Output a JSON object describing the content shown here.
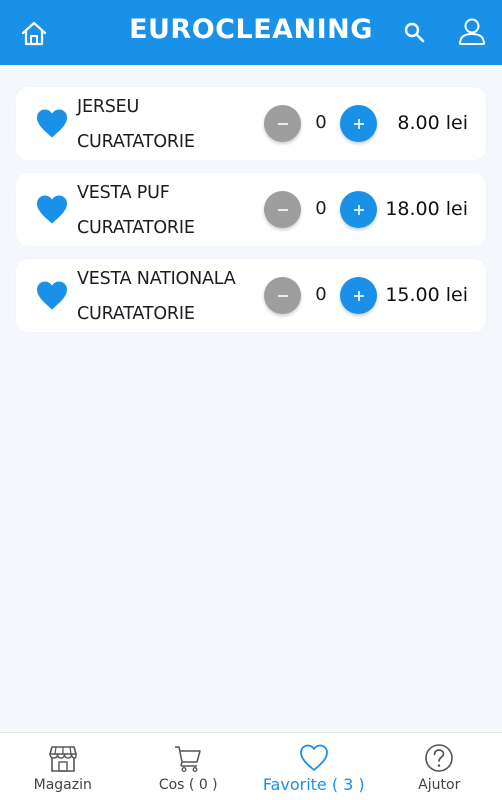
{
  "header": {
    "title": "EUROCLEANING",
    "accent_color": "#1a91e8",
    "icons": [
      "home-icon",
      "search-icon",
      "user-icon"
    ]
  },
  "items": [
    {
      "name": "JERSEU",
      "category": "CURATATORIE",
      "quantity": "0",
      "price": "8.00 lei",
      "favorite": true
    },
    {
      "name": "VESTA PUF",
      "category": "CURATATORIE",
      "quantity": "0",
      "price": "18.00 lei",
      "favorite": true
    },
    {
      "name": "VESTA NATIONALA",
      "category": "CURATATORIE",
      "quantity": "0",
      "price": "15.00 lei",
      "favorite": true
    }
  ],
  "bottom_nav": {
    "active": "favorite",
    "tabs": [
      {
        "label": "Magazin",
        "icon": "shop-icon"
      },
      {
        "label": "Cos ( 0 )",
        "icon": "cart-icon"
      },
      {
        "label": "Favorite ( 3 )",
        "icon": "heart-icon"
      },
      {
        "label": "Ajutor",
        "icon": "help-icon"
      }
    ]
  }
}
